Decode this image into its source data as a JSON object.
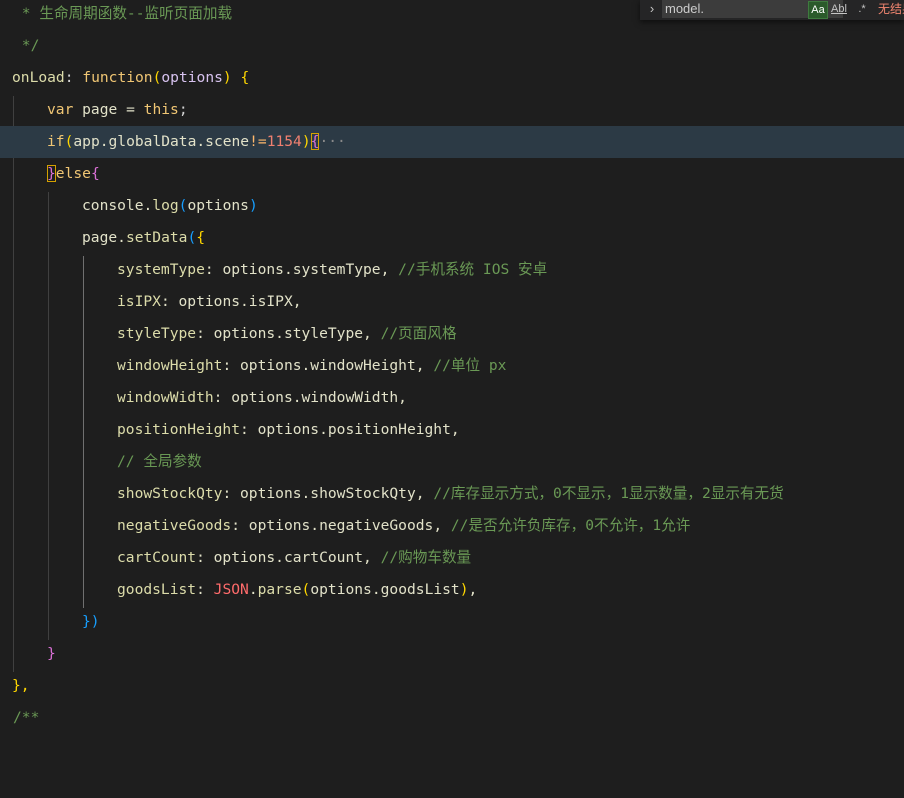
{
  "code": {
    "l1_comment": " * 生命周期函数--监听页面加载",
    "l2_comment": " */",
    "l3_key": "onLoad",
    "l3_colon": ": ",
    "l3_function": "function",
    "l3_param": "options",
    "l3_brace": " {",
    "l4_var": "var",
    "l4_name": " page = ",
    "l4_this": "this",
    "l4_semi": ";",
    "l5_if": "if",
    "l5_expr": "app.globalData.scene",
    "l5_op": "!=",
    "l5_num": "1154",
    "l5_fold": "···",
    "l6_close": "}",
    "l6_else": "else",
    "l6_open": "{",
    "l7_obj": "console.",
    "l7_fn": "log",
    "l7_arg": "options",
    "l8_obj": "page.",
    "l8_fn": "setData",
    "l9_key": "systemType",
    "l9_val": ": options.systemType, ",
    "l9_comment": "//手机系统 IOS 安卓",
    "l10_key": "isIPX",
    "l10_val": ": options.isIPX,",
    "l11_key": "styleType",
    "l11_val": ": options.styleType, ",
    "l11_comment": "//页面风格",
    "l12_key": "windowHeight",
    "l12_val": ": options.windowHeight, ",
    "l12_comment": "//单位 px",
    "l13_key": "windowWidth",
    "l13_val": ": options.windowWidth,",
    "l14_key": "positionHeight",
    "l14_val": ": options.positionHeight,",
    "l15_comment": "// 全局参数",
    "l16_key": "showStockQty",
    "l16_val": ": options.showStockQty, ",
    "l16_comment": "//库存显示方式，0不显示，1显示数量，2显示有无货",
    "l17_key": "negativeGoods",
    "l17_val": ": options.negativeGoods, ",
    "l17_comment": "//是否允许负库存，0不允许，1允许",
    "l18_key": "cartCount",
    "l18_val": ": options.cartCount, ",
    "l18_comment": "//购物车数量",
    "l19_key": "goodsList",
    "l19_json": "JSON",
    "l19_fn": "parse",
    "l19_arg": "options.goodsList",
    "l20_close": "})",
    "l21_close": "}",
    "l22_close": "},",
    "l23_comment": "/**"
  },
  "find": {
    "toggle": "›",
    "query": "model.",
    "match_case": "Aa",
    "whole_word": "Abl",
    "regex": ".*",
    "result": "无结果"
  },
  "colors": {
    "background": "#1e1e1e",
    "highlight_line": "#2c3a45",
    "comment": "#6a9955"
  }
}
